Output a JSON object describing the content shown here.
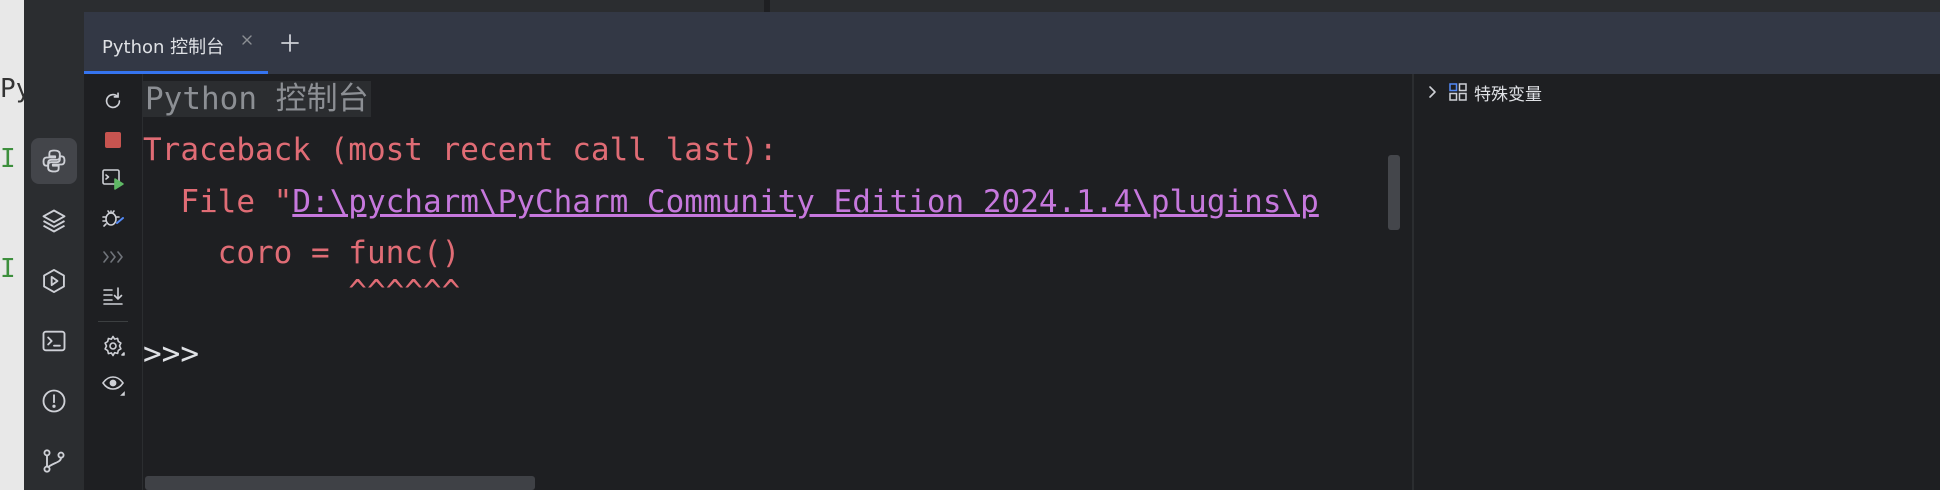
{
  "editor_fragments": [
    "Py",
    "I",
    "I"
  ],
  "tabs": [
    {
      "label": "Python 控制台",
      "active": true
    }
  ],
  "activity_bar": {
    "items": [
      {
        "name": "python-packages",
        "icon": "python-icon",
        "active": true
      },
      {
        "name": "layers",
        "icon": "layers-icon",
        "active": false
      },
      {
        "name": "services",
        "icon": "services-icon",
        "active": false
      },
      {
        "name": "terminal",
        "icon": "terminal-icon",
        "active": false
      },
      {
        "name": "problems",
        "icon": "problems-icon",
        "active": false
      },
      {
        "name": "version-control",
        "icon": "git-branch-icon",
        "active": false
      }
    ]
  },
  "console_toolbar": {
    "items": [
      {
        "name": "rerun",
        "icon": "rerun-icon"
      },
      {
        "name": "stop",
        "icon": "stop-icon"
      },
      {
        "name": "run-in-console",
        "icon": "console-run-icon"
      },
      {
        "name": "attach-debugger",
        "icon": "debug-icon"
      },
      {
        "name": "execute-history",
        "icon": "chevrons-right-icon"
      },
      {
        "name": "scroll-to-end",
        "icon": "scroll-to-end-icon"
      },
      {
        "name": "settings",
        "icon": "gear-icon"
      },
      {
        "name": "show-variables",
        "icon": "eye-icon"
      }
    ]
  },
  "console": {
    "title": "Python 控制台",
    "traceback_header": "Traceback (most recent call last):",
    "file_prefix": "  File \"",
    "file_path": "D:\\pycharm\\PyCharm Community Edition 2024.1.4\\plugins\\p",
    "code_line": "    coro = func()",
    "caret_line": "           ^^^^^^",
    "prompt": ">>>"
  },
  "variables_panel": {
    "special_variables_label": "特殊变量"
  },
  "colors": {
    "error_text": "#e06c75",
    "link_text": "#c678dd",
    "accent": "#3574f0",
    "stop_red": "#c75450",
    "run_green": "#5fb865",
    "debug_blue": "#548af7"
  }
}
